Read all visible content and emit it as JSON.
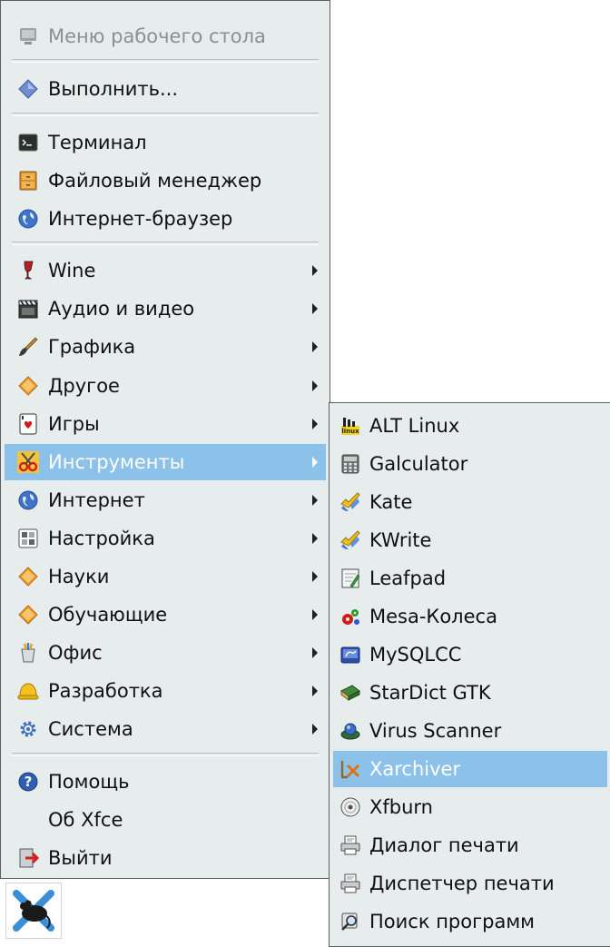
{
  "main_menu": {
    "header": "Меню рабочего стола",
    "run": "Выполнить...",
    "terminal": "Терминал",
    "file_manager": "Файловый менеджер",
    "web_browser": "Интернет-браузер",
    "categories": [
      {
        "label": "Wine",
        "icon": "wine-glass-icon"
      },
      {
        "label": "Аудио и видео",
        "icon": "clapperboard-icon"
      },
      {
        "label": "Графика",
        "icon": "brush-icon"
      },
      {
        "label": "Другое",
        "icon": "diamond-icon"
      },
      {
        "label": "Игры",
        "icon": "playing-card-icon"
      },
      {
        "label": "Инструменты",
        "icon": "scissors-icon"
      },
      {
        "label": "Интернет",
        "icon": "globe-icon"
      },
      {
        "label": "Настройка",
        "icon": "settings-icon"
      },
      {
        "label": "Науки",
        "icon": "diamond-icon"
      },
      {
        "label": "Обучающие",
        "icon": "diamond-icon"
      },
      {
        "label": "Офис",
        "icon": "office-icon"
      },
      {
        "label": "Разработка",
        "icon": "hardhat-icon"
      },
      {
        "label": "Система",
        "icon": "gear-icon"
      }
    ],
    "help": "Помощь",
    "about": "Об Xfce",
    "logout": "Выйти",
    "highlighted": "Инструменты"
  },
  "submenu": {
    "items": [
      {
        "label": "ALT Linux",
        "icon": "alt-linux-icon"
      },
      {
        "label": "Galculator",
        "icon": "calculator-icon"
      },
      {
        "label": "Kate",
        "icon": "kate-icon"
      },
      {
        "label": "KWrite",
        "icon": "kwrite-icon"
      },
      {
        "label": "Leafpad",
        "icon": "notepad-icon"
      },
      {
        "label": "Mesa-Колеса",
        "icon": "gears-icon"
      },
      {
        "label": "MySQLCC",
        "icon": "database-icon"
      },
      {
        "label": "StarDict GTK",
        "icon": "dictionary-icon"
      },
      {
        "label": "Virus Scanner",
        "icon": "virus-scanner-icon"
      },
      {
        "label": "Xarchiver",
        "icon": "archive-icon"
      },
      {
        "label": "Xfburn",
        "icon": "disc-icon"
      },
      {
        "label": "Диалог печати",
        "icon": "printer-icon"
      },
      {
        "label": "Диспетчер печати",
        "icon": "printer-icon"
      },
      {
        "label": "Поиск программ",
        "icon": "search-icon"
      }
    ],
    "highlighted": "Xarchiver"
  },
  "colors": {
    "menu_bg": "#e7eced",
    "highlight": "#8cc2ea",
    "border": "#5b5f60"
  }
}
